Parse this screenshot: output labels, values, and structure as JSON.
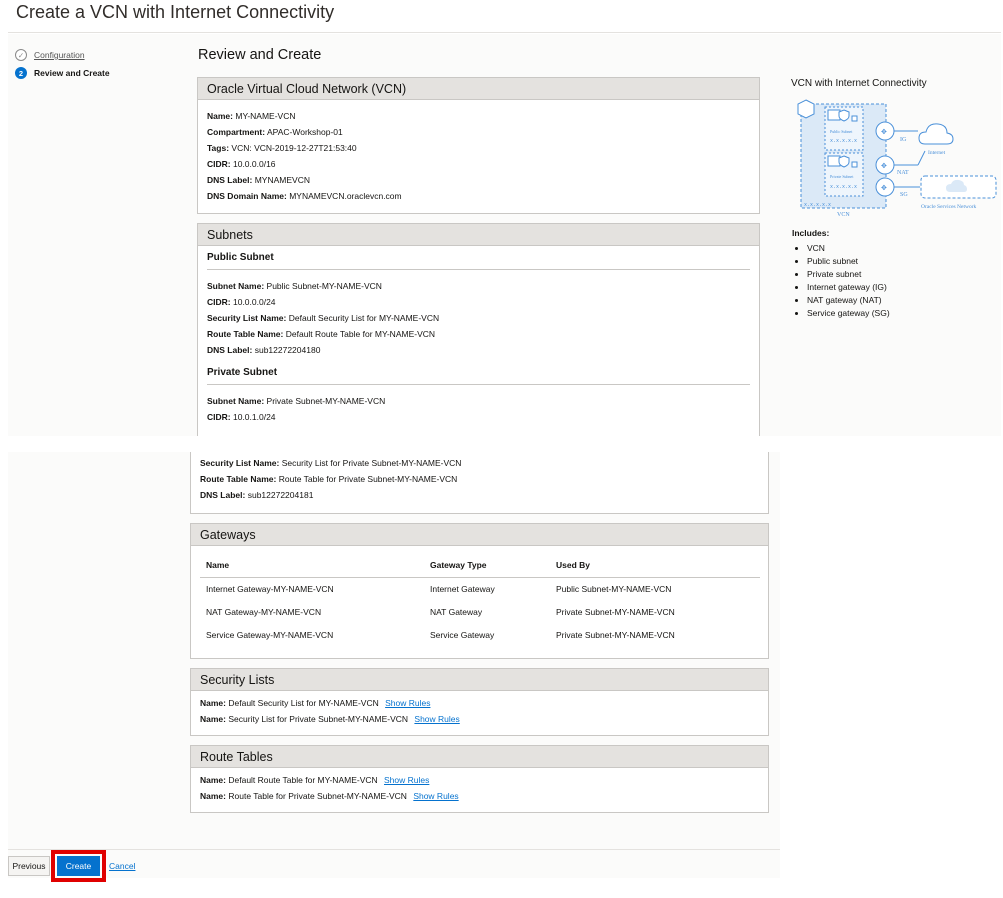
{
  "page_title": "Create a VCN with Internet Connectivity",
  "steps": [
    {
      "number": "✓",
      "label": "Configuration"
    },
    {
      "number": "2",
      "label": "Review and Create"
    }
  ],
  "section_heading": "Review and Create",
  "vcn": {
    "header": "Oracle Virtual Cloud Network (VCN)",
    "fields": [
      {
        "label": "Name:",
        "value": "MY-NAME-VCN"
      },
      {
        "label": "Compartment:",
        "value": "APAC-Workshop-01"
      },
      {
        "label": "Tags:",
        "value": "VCN: VCN-2019-12-27T21:53:40"
      },
      {
        "label": "CIDR:",
        "value": "10.0.0.0/16"
      },
      {
        "label": "DNS Label:",
        "value": "MYNAMEVCN"
      },
      {
        "label": "DNS Domain Name:",
        "value": "MYNAMEVCN.oraclevcn.com"
      }
    ]
  },
  "subnets": {
    "header": "Subnets",
    "public": {
      "title": "Public Subnet",
      "fields": [
        {
          "label": "Subnet Name:",
          "value": "Public Subnet-MY-NAME-VCN"
        },
        {
          "label": "CIDR:",
          "value": "10.0.0.0/24"
        },
        {
          "label": "Security List Name:",
          "value": "Default Security List for MY-NAME-VCN"
        },
        {
          "label": "Route Table Name:",
          "value": "Default Route Table for MY-NAME-VCN"
        },
        {
          "label": "DNS Label:",
          "value": "sub12272204180"
        }
      ]
    },
    "private": {
      "title": "Private Subnet",
      "fields": [
        {
          "label": "Subnet Name:",
          "value": "Private Subnet-MY-NAME-VCN"
        },
        {
          "label": "CIDR:",
          "value": "10.0.1.0/24"
        }
      ],
      "fields_continued": [
        {
          "label": "Security List Name:",
          "value": "Security List for Private Subnet-MY-NAME-VCN"
        },
        {
          "label": "Route Table Name:",
          "value": "Route Table for Private Subnet-MY-NAME-VCN"
        },
        {
          "label": "DNS Label:",
          "value": "sub12272204181"
        }
      ]
    }
  },
  "gateways": {
    "header": "Gateways",
    "columns": [
      "Name",
      "Gateway Type",
      "Used By"
    ],
    "rows": [
      [
        "Internet Gateway-MY-NAME-VCN",
        "Internet Gateway",
        "Public Subnet-MY-NAME-VCN"
      ],
      [
        "NAT Gateway-MY-NAME-VCN",
        "NAT Gateway",
        "Private Subnet-MY-NAME-VCN"
      ],
      [
        "Service Gateway-MY-NAME-VCN",
        "Service Gateway",
        "Private Subnet-MY-NAME-VCN"
      ]
    ]
  },
  "security_lists": {
    "header": "Security Lists",
    "items": [
      {
        "label": "Name:",
        "value": "Default Security List for MY-NAME-VCN",
        "link": "Show Rules"
      },
      {
        "label": "Name:",
        "value": "Security List for Private Subnet-MY-NAME-VCN",
        "link": "Show Rules"
      }
    ]
  },
  "route_tables": {
    "header": "Route Tables",
    "items": [
      {
        "label": "Name:",
        "value": "Default Route Table for MY-NAME-VCN",
        "link": "Show Rules"
      },
      {
        "label": "Name:",
        "value": "Route Table for Private Subnet-MY-NAME-VCN",
        "link": "Show Rules"
      }
    ]
  },
  "diagram": {
    "title": "VCN with Internet Connectivity",
    "labels": {
      "ig": "IG",
      "nat": "NAT",
      "sg": "SG",
      "internet": "Internet",
      "osn": "Oracle Services Network",
      "vcn": "VCN",
      "public_subnet": "Public Subnet",
      "private_subnet": "Private Subnet",
      "cidr_placeholder": "x.x.x.x.x",
      "vcn_cidr_placeholder": "x.x.x.x.x"
    },
    "accent": "#4a90d9"
  },
  "includes": {
    "label": "Includes:",
    "items": [
      "VCN",
      "Public subnet",
      "Private subnet",
      "Internet gateway (IG)",
      "NAT gateway (NAT)",
      "Service gateway (SG)"
    ]
  },
  "footer": {
    "previous": "Previous",
    "create": "Create",
    "cancel": "Cancel"
  },
  "colors": {
    "primary": "#0572ce",
    "highlight": "#e00000",
    "header_bg": "#e4e2df"
  }
}
